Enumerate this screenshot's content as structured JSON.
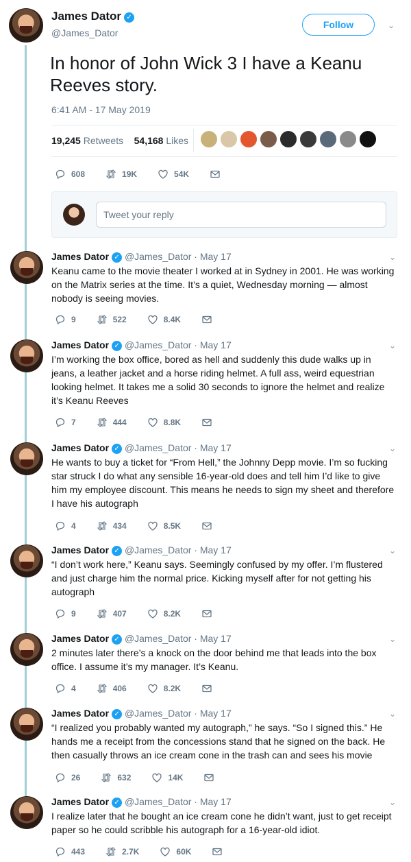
{
  "author": {
    "name": "James Dator",
    "handle": "@James_Dator"
  },
  "main_tweet": {
    "follow_label": "Follow",
    "text": "In honor of John Wick 3 I have a Keanu Reeves story.",
    "timestamp": "6:41 AM - 17 May 2019",
    "retweets_count": "19,245",
    "retweets_label": "Retweets",
    "likes_count": "54,168",
    "likes_label": "Likes",
    "actions": {
      "replies": "608",
      "retweets": "19K",
      "likes": "54K"
    }
  },
  "reply_box": {
    "placeholder": "Tweet your reply"
  },
  "replies": [
    {
      "meta": "@James_Dator · May 17",
      "text": "Keanu came to the movie theater I worked at in Sydney in 2001. He was working on the Matrix series at the time. It’s a quiet, Wednesday morning — almost nobody is seeing movies.",
      "replies": "9",
      "retweets": "522",
      "likes": "8.4K"
    },
    {
      "meta": "@James_Dator · May 17",
      "text": "I’m working the box office, bored as hell and suddenly this dude walks up in jeans, a leather jacket and a horse riding helmet. A full ass, weird equestrian looking helmet. It takes me a solid 30 seconds to ignore the helmet and realize it’s Keanu Reeves",
      "replies": "7",
      "retweets": "444",
      "likes": "8.8K"
    },
    {
      "meta": "@James_Dator · May 17",
      "text": "He wants to buy a ticket for “From Hell,” the Johnny Depp movie. I’m so fucking star struck I do what any sensible 16-year-old does and tell him I’d like to give him my employee discount. This means he needs to sign my sheet and therefore I have his autograph",
      "replies": "4",
      "retweets": "434",
      "likes": "8.5K"
    },
    {
      "meta": "@James_Dator · May 17",
      "text": "“I don’t work here,” Keanu says. Seemingly confused by my offer. I’m flustered and just charge him the normal price. Kicking myself after for not getting his autograph",
      "replies": "9",
      "retweets": "407",
      "likes": "8.2K"
    },
    {
      "meta": "@James_Dator · May 17",
      "text": "2 minutes later there’s a knock on the door behind me that leads into the box office. I assume it’s my manager. It’s Keanu.",
      "replies": "4",
      "retweets": "406",
      "likes": "8.2K"
    },
    {
      "meta": "@James_Dator · May 17",
      "text": "“I realized you probably wanted my autograph,” he says. “So I signed this.” He hands me a receipt from the concessions stand that he signed on the back. He then casually throws an ice cream cone in the trash can and sees his movie",
      "replies": "26",
      "retweets": "632",
      "likes": "14K"
    },
    {
      "meta": "@James_Dator · May 17",
      "text": "I realize later that he bought an ice cream cone he didn’t want, just to get receipt paper so he could scribble his autograph for a 16-year-old idiot.",
      "replies": "443",
      "retweets": "2.7K",
      "likes": "60K"
    }
  ],
  "colors": {
    "accent": "#1da1f2",
    "thread_line": "#9fd0d9",
    "muted": "#657786"
  }
}
